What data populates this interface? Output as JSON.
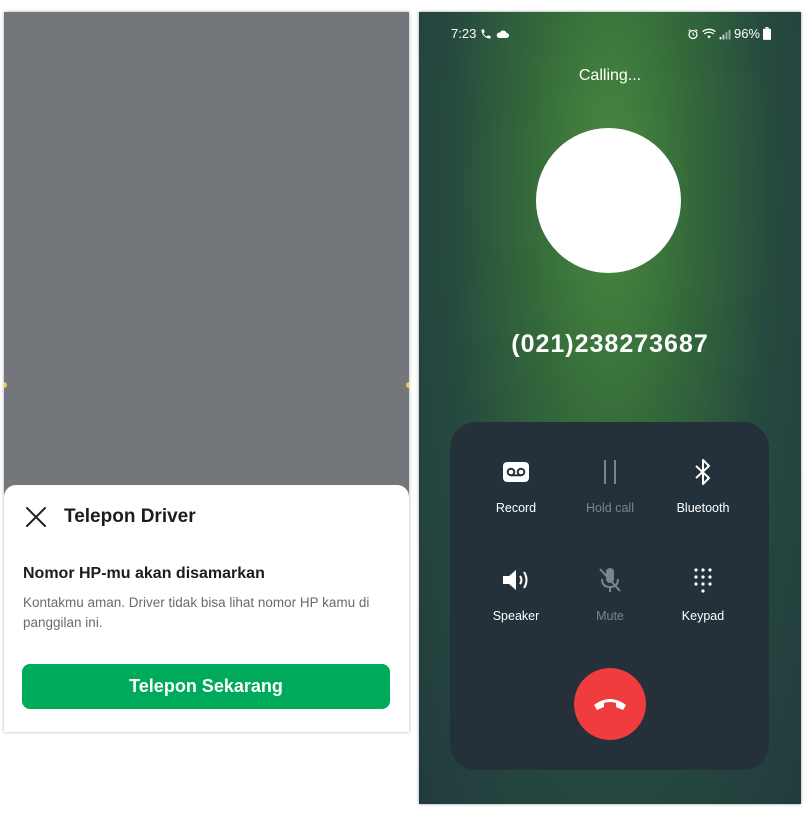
{
  "left": {
    "sheet": {
      "title": "Telepon Driver",
      "heading": "Nomor HP-mu akan disamarkan",
      "description": "Kontakmu aman. Driver tidak bisa lihat nomor HP kamu di panggilan ini.",
      "button_label": "Telepon Sekarang",
      "button_color": "#00aa5b"
    }
  },
  "phone": {
    "status_bar": {
      "time": "7:23",
      "battery": "96%",
      "icons_left": [
        "phone-icon",
        "cloud-icon"
      ],
      "icons_right": [
        "alarm-icon",
        "wifi-icon",
        "signal-icon",
        "battery-icon"
      ]
    },
    "calling_label": "Calling...",
    "number": "(021)238273687",
    "controls": {
      "record": {
        "label": "Record",
        "icon": "voicemail-icon"
      },
      "hold": {
        "label": "Hold call",
        "icon": "pause-icon"
      },
      "bluetooth": {
        "label": "Bluetooth",
        "icon": "bluetooth-icon"
      },
      "speaker": {
        "label": "Speaker",
        "icon": "speaker-icon"
      },
      "mute": {
        "label": "Mute",
        "icon": "mic-off-icon"
      },
      "keypad": {
        "label": "Keypad",
        "icon": "keypad-icon"
      }
    },
    "end_call": {
      "icon": "end-call-icon",
      "color": "#f03c3c"
    }
  }
}
